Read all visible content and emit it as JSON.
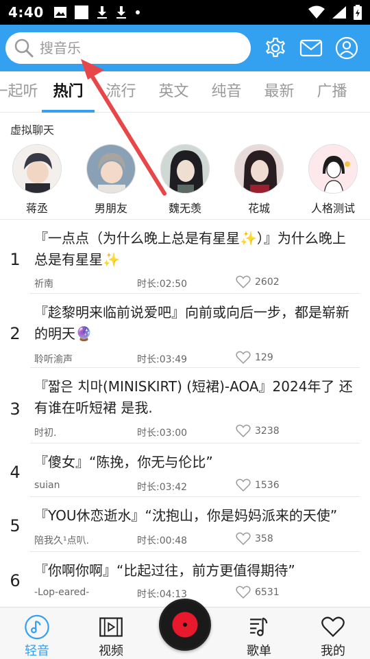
{
  "status_bar": {
    "time": "4:40"
  },
  "header": {
    "search_placeholder": "搜音乐"
  },
  "tabs": [
    {
      "label": "一起听"
    },
    {
      "label": "热门"
    },
    {
      "label": "流行"
    },
    {
      "label": "英文"
    },
    {
      "label": "纯音"
    },
    {
      "label": "最新"
    },
    {
      "label": "广播"
    }
  ],
  "virtual_chat": {
    "title": "虚拟聊天",
    "characters": [
      {
        "name": "蒋丞"
      },
      {
        "name": "男朋友"
      },
      {
        "name": "魏无羡"
      },
      {
        "name": "花城"
      },
      {
        "name": "人格测试"
      }
    ]
  },
  "songs": [
    {
      "rank": "1",
      "title": "『一点点（为什么晚上总是有星星✨）』为什么晚上总是有星星✨",
      "user": "祈南",
      "duration": "时长:02:50",
      "likes": "2602"
    },
    {
      "rank": "2",
      "title": "『趁黎明来临前说爱吧』向前或向后一步，都是崭新的明天🔮",
      "user": "聆听渝声",
      "duration": "时长:03:49",
      "likes": "129"
    },
    {
      "rank": "3",
      "title": "『짧은 치마(MINISKIRT) (短裙)-AOA』2024年了 还有谁在听短裙 是我.",
      "user": "时初.",
      "duration": "时长:03:00",
      "likes": "3238"
    },
    {
      "rank": "4",
      "title": "『傻女』“陈挽，你无与伦比”",
      "user": "suian",
      "duration": "时长:03:42",
      "likes": "1536"
    },
    {
      "rank": "5",
      "title": "『YOU休恋逝水』“沈抱山，你是妈妈派来的天使”",
      "user": "陪我久¹点叭.",
      "duration": "时长:00:48",
      "likes": "358"
    },
    {
      "rank": "6",
      "title": "『你啊你啊』“比起过往，前方更值得期待”",
      "user": "-Lop-eared-",
      "duration": "时长:04:13",
      "likes": "6531"
    }
  ],
  "bottom_nav": [
    {
      "label": "轻音"
    },
    {
      "label": "视频"
    },
    {
      "label": "歌单"
    },
    {
      "label": "我的"
    }
  ],
  "colors": {
    "accent": "#34a0f0",
    "arrow": "#e8474a"
  }
}
